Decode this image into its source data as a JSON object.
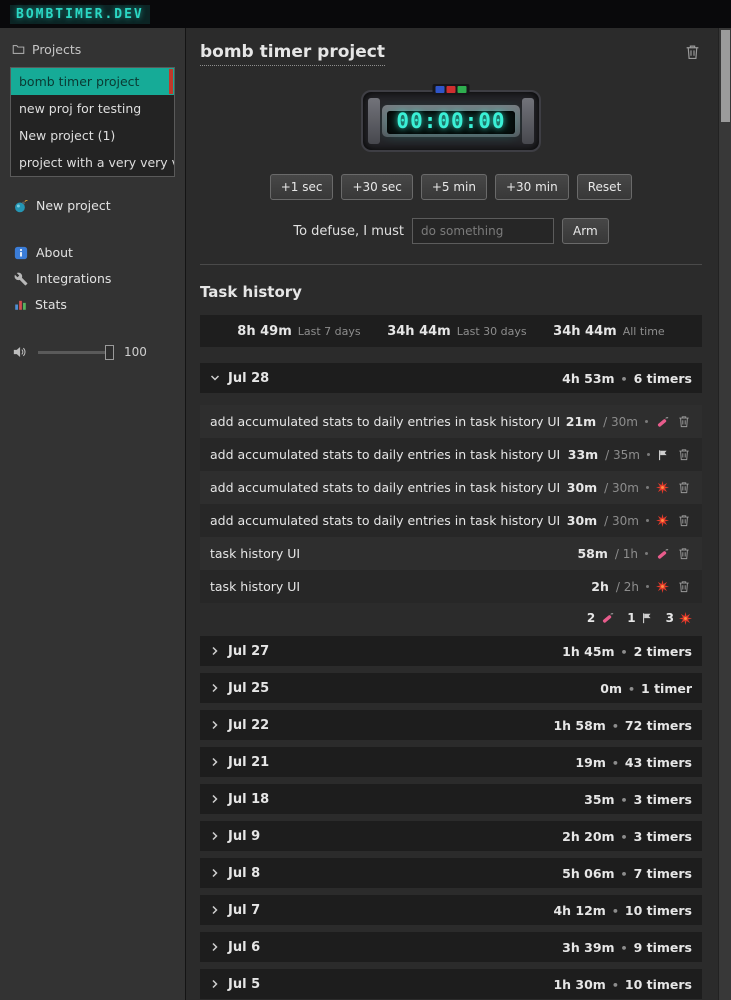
{
  "topbar": {
    "logo": "BOMBTIMER.DEV"
  },
  "sidebar": {
    "projects_header": "Projects",
    "projects": [
      {
        "name": "bomb timer project",
        "selected": true
      },
      {
        "name": "new proj for testing"
      },
      {
        "name": "New project (1)"
      },
      {
        "name": "project with a very very v..."
      }
    ],
    "new_project_label": "New project",
    "nav": [
      {
        "label": "About"
      },
      {
        "label": "Integrations"
      },
      {
        "label": "Stats"
      }
    ],
    "volume": {
      "value": "100"
    }
  },
  "main": {
    "title": "bomb timer project",
    "timer": {
      "display": "00:00:00"
    },
    "controls": [
      "+1 sec",
      "+30 sec",
      "+5 min",
      "+30 min",
      "Reset"
    ],
    "defuse": {
      "label": "To defuse, I must",
      "placeholder": "do something",
      "arm_label": "Arm"
    },
    "task_history": {
      "heading": "Task history",
      "stats": [
        {
          "value": "8h 49m",
          "label": "Last 7 days"
        },
        {
          "value": "34h 44m",
          "label": "Last 30 days"
        },
        {
          "value": "34h 44m",
          "label": "All time"
        }
      ],
      "expanded_day": {
        "date": "Jul 28",
        "total": "4h 53m",
        "timers": "6 timers",
        "tasks": [
          {
            "name": "add accumulated stats to daily entries in task history UI",
            "elapsed": "21m",
            "total": "30m",
            "icon": "dynamite"
          },
          {
            "name": "add accumulated stats to daily entries in task history UI",
            "elapsed": "33m",
            "total": "35m",
            "icon": "flag"
          },
          {
            "name": "add accumulated stats to daily entries in task history UI",
            "elapsed": "30m",
            "total": "30m",
            "icon": "explosion"
          },
          {
            "name": "add accumulated stats to daily entries in task history UI",
            "elapsed": "30m",
            "total": "30m",
            "icon": "explosion"
          },
          {
            "name": "task history UI",
            "elapsed": "58m",
            "total": "1h",
            "icon": "dynamite"
          },
          {
            "name": "task history UI",
            "elapsed": "2h",
            "total": "2h",
            "icon": "explosion"
          }
        ],
        "summary": [
          {
            "count": "2",
            "icon": "dynamite"
          },
          {
            "count": "1",
            "icon": "flag"
          },
          {
            "count": "3",
            "icon": "explosion"
          }
        ]
      },
      "collapsed_days": [
        {
          "date": "Jul 27",
          "total": "1h 45m",
          "timers": "2 timers"
        },
        {
          "date": "Jul 25",
          "total": "0m",
          "timers": "1 timer"
        },
        {
          "date": "Jul 22",
          "total": "1h 58m",
          "timers": "72 timers"
        },
        {
          "date": "Jul 21",
          "total": "19m",
          "timers": "43 timers"
        },
        {
          "date": "Jul 18",
          "total": "35m",
          "timers": "3 timers"
        },
        {
          "date": "Jul 9",
          "total": "2h 20m",
          "timers": "3 timers"
        },
        {
          "date": "Jul 8",
          "total": "5h 06m",
          "timers": "7 timers"
        },
        {
          "date": "Jul 7",
          "total": "4h 12m",
          "timers": "10 timers"
        },
        {
          "date": "Jul 6",
          "total": "3h 39m",
          "timers": "9 timers"
        },
        {
          "date": "Jul 5",
          "total": "1h 30m",
          "timers": "10 timers"
        }
      ]
    }
  }
}
